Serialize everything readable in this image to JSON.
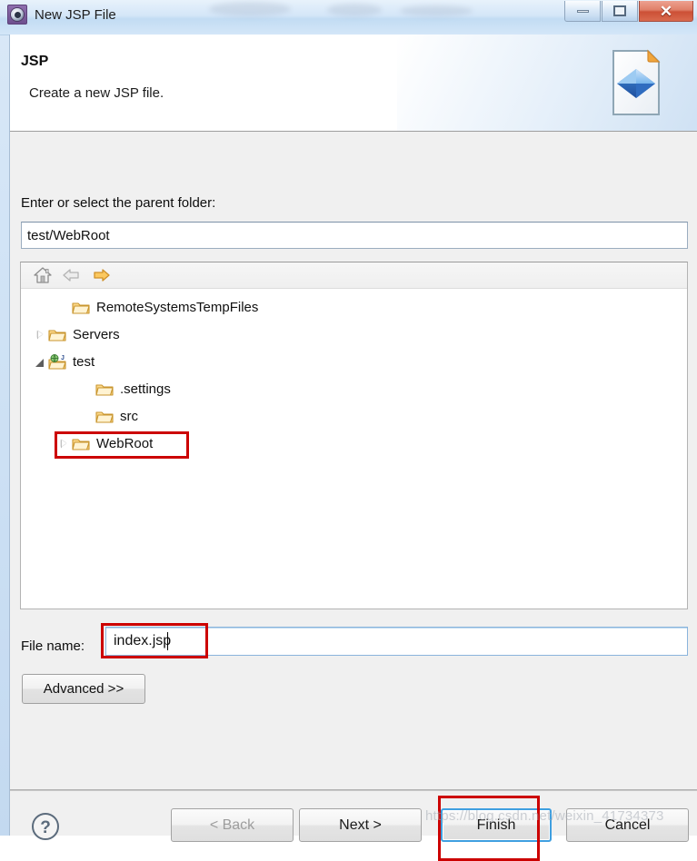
{
  "window": {
    "title": "New JSP File",
    "app_icon": "gear-icon",
    "buttons": {
      "minimize": "minimize-icon",
      "maximize": "maximize-icon",
      "close": "close-icon"
    }
  },
  "header": {
    "title": "JSP",
    "description": "Create a new JSP file.",
    "icon": "jsp-file-icon"
  },
  "form": {
    "parent_folder_label": "Enter or select the parent folder:",
    "parent_folder_value": "test/WebRoot",
    "file_name_label": "File name:",
    "file_name_value": "index.jsp",
    "advanced_label": "Advanced >>"
  },
  "tree_toolbar": {
    "home_icon": "home-icon",
    "back_icon": "back-arrow-icon",
    "forward_icon": "forward-arrow-icon"
  },
  "tree": {
    "nodes": [
      {
        "label": "RemoteSystemsTempFiles",
        "indent": 1,
        "twisty": "none",
        "icon": "folder-icon"
      },
      {
        "label": "Servers",
        "indent": 0,
        "twisty": "collapsed",
        "icon": "folder-icon"
      },
      {
        "label": "test",
        "indent": 0,
        "twisty": "expanded",
        "icon": "web-project-icon"
      },
      {
        "label": ".settings",
        "indent": 2,
        "twisty": "none",
        "icon": "folder-icon"
      },
      {
        "label": "src",
        "indent": 2,
        "twisty": "none",
        "icon": "folder-icon"
      },
      {
        "label": "WebRoot",
        "indent": 1,
        "twisty": "collapsed",
        "icon": "folder-icon"
      }
    ]
  },
  "footer": {
    "help_icon": "help-icon",
    "back_label": "< Back",
    "next_label": "Next >",
    "finish_label": "Finish",
    "cancel_label": "Cancel"
  },
  "annotations": {
    "highlight_color": "#cc0000",
    "watermark": "https://blog.csdn.net/weixin_41734373"
  }
}
